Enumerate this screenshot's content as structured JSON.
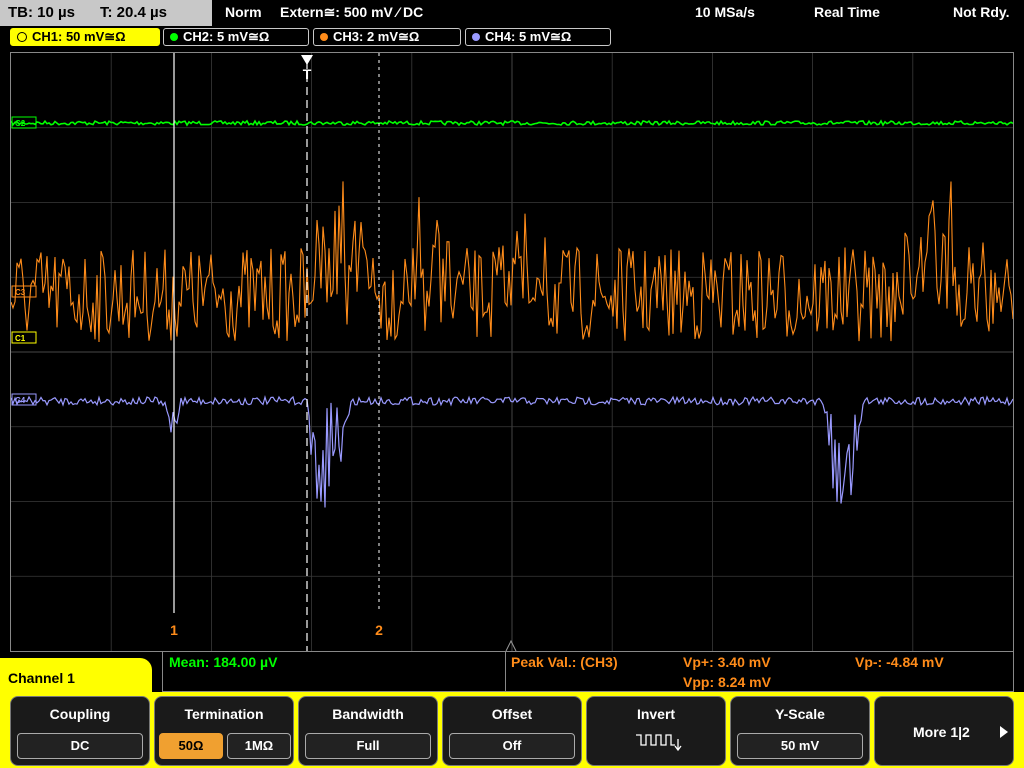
{
  "topbar": {
    "timebase": "TB: 10 µs",
    "trigger_time": "T: 20.4 µs",
    "mode": "Norm",
    "trigger_source": "Extern≅: 500 mV ⁄ DC",
    "sample_rate": "10 MSa/s",
    "acq_mode": "Real Time",
    "status": "Not Rdy."
  },
  "channels": [
    {
      "label": "CH1: 50 mV≅Ω",
      "color": "#ffff00"
    },
    {
      "label": "CH2: 5 mV≅Ω",
      "color": "#00ff00"
    },
    {
      "label": "CH3: 2 mV≅Ω",
      "color": "#ff8c1a"
    },
    {
      "label": "CH4: 5 mV≅Ω",
      "color": "#9a9aff"
    }
  ],
  "scope": {
    "markers": {
      "c1": "1",
      "c2": "2",
      "trig": "T"
    },
    "ch_markers": {
      "ch2": "C2",
      "ch3": "C3",
      "ch1": "C1",
      "ch4": "C4"
    }
  },
  "measurements": {
    "mean": "Mean: 184.00 µV",
    "peak_label": "Peak Val.:  (CH3)",
    "vp_plus": "Vp+: 3.40 mV",
    "vp_minus": "Vp-: -4.84 mV",
    "vpp": "Vpp: 8.24 mV"
  },
  "menu": {
    "channel_label": "Channel 1",
    "coupling_title": "Coupling",
    "coupling_value": "DC",
    "termination_title": "Termination",
    "term_50": "50Ω",
    "term_1m": "1MΩ",
    "bandwidth_title": "Bandwidth",
    "bandwidth_value": "Full",
    "offset_title": "Offset",
    "offset_value": "Off",
    "invert_title": "Invert",
    "yscale_title": "Y-Scale",
    "yscale_value": "50 mV",
    "more_label": "More 1|2"
  },
  "colors": {
    "ch1": "#ffff00",
    "ch2": "#00ff00",
    "ch3": "#ff8c1a",
    "ch4": "#9a9aff"
  }
}
